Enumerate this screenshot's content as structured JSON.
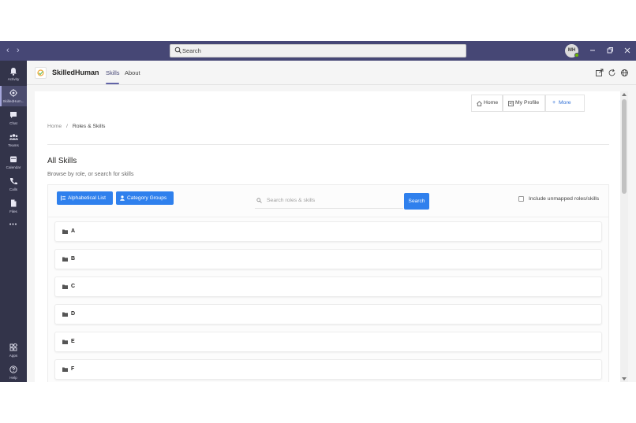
{
  "titlebar": {
    "search_placeholder": "Search",
    "avatar_initials": "MH",
    "back_glyph": "‹",
    "forward_glyph": "›"
  },
  "rail": {
    "items": [
      {
        "label": "Activity",
        "icon": "bell-icon"
      },
      {
        "label": "SkilledHum...",
        "icon": "app-icon"
      },
      {
        "label": "Chat",
        "icon": "chat-icon"
      },
      {
        "label": "Teams",
        "icon": "teams-icon"
      },
      {
        "label": "Calendar",
        "icon": "calendar-icon"
      },
      {
        "label": "Calls",
        "icon": "phone-icon"
      },
      {
        "label": "Files",
        "icon": "file-icon"
      },
      {
        "label": "Apps",
        "icon": "apps-icon"
      },
      {
        "label": "Help",
        "icon": "help-icon"
      }
    ],
    "more_glyph": "•••"
  },
  "app": {
    "name": "SkilledHuman",
    "tabs": [
      {
        "label": "Skills",
        "active": true
      },
      {
        "label": "About",
        "active": false
      }
    ]
  },
  "toolbar": {
    "home": "Home",
    "profile": "My Profile",
    "more": "More"
  },
  "breadcrumb": {
    "home": "Home",
    "sep": "/",
    "current": "Roles & Skills"
  },
  "page": {
    "title": "All Skills",
    "subtitle": "Browse by role, or search for skills"
  },
  "controls": {
    "alpha_button": "Alphabetical List",
    "category_button": "Category Groups",
    "search_placeholder": "Search roles & skills",
    "search_button": "Search",
    "include_unmapped": "Include unmapped roles/skills"
  },
  "letters": [
    "A",
    "B",
    "C",
    "D",
    "E",
    "F"
  ],
  "colors": {
    "teams_header": "#464775",
    "rail": "#33344a",
    "accent": "#6264a7",
    "primary_button": "#2f80ed"
  }
}
